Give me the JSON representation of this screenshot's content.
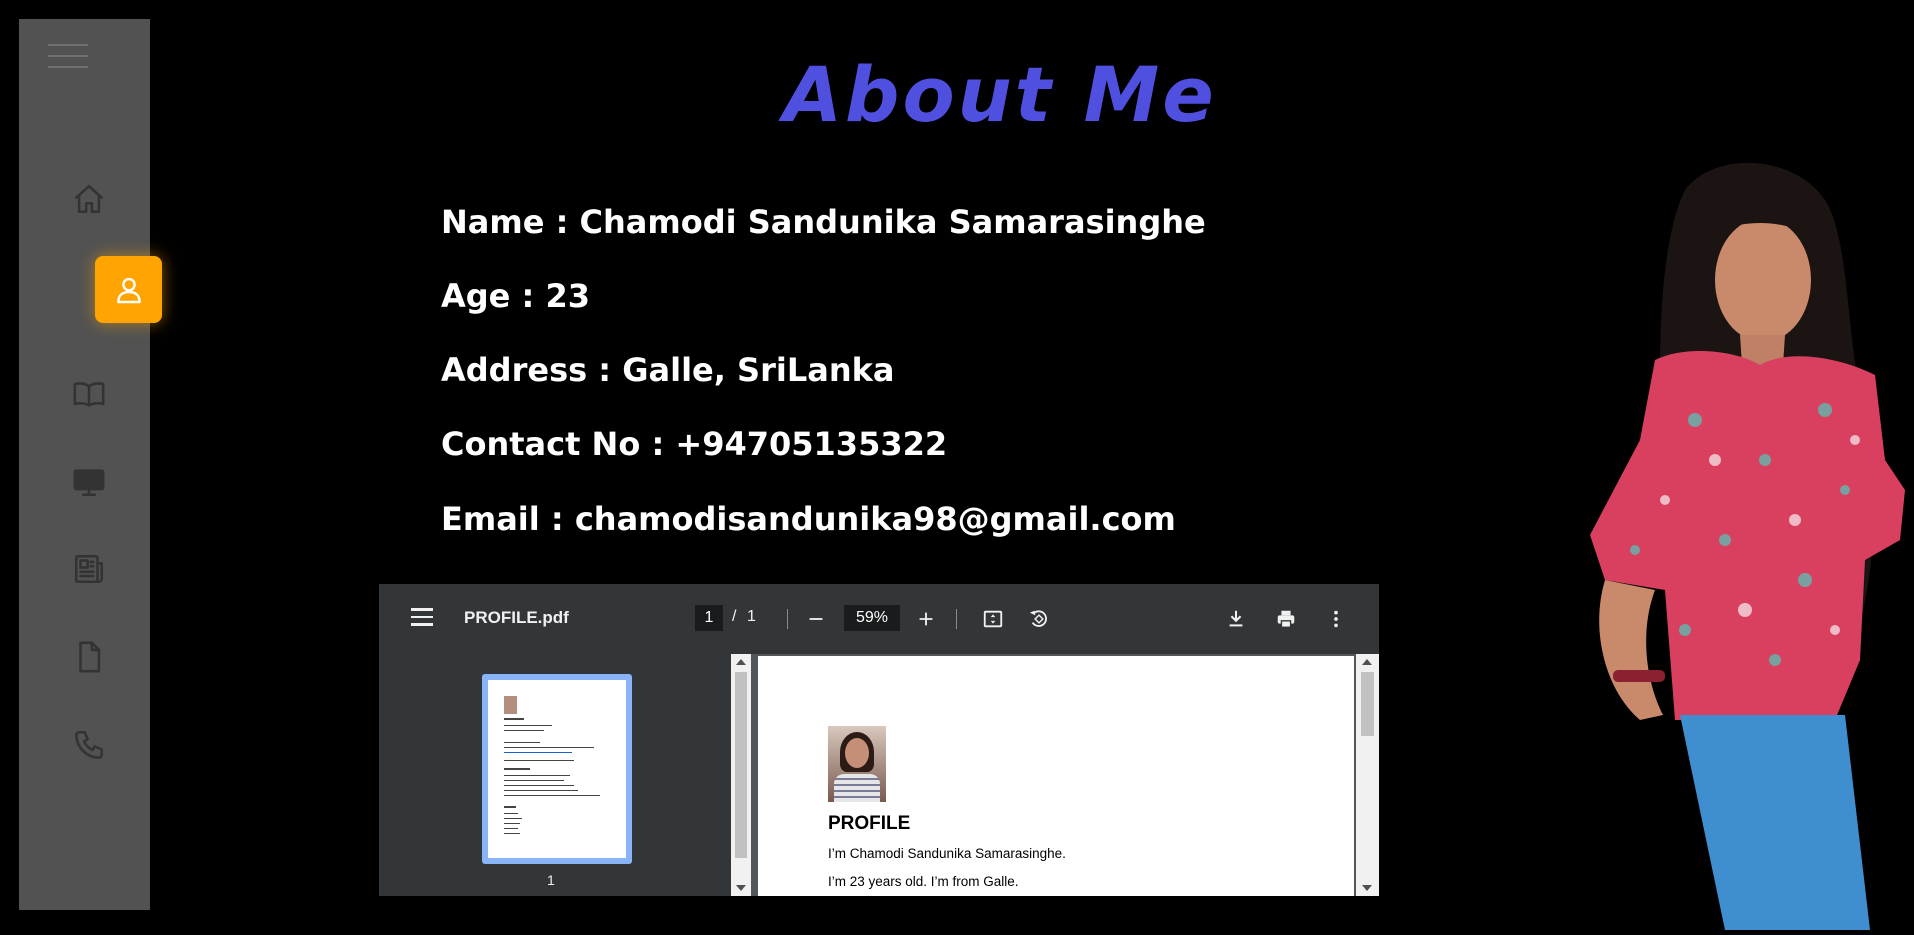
{
  "sidebar": {
    "items": [
      {
        "name": "home",
        "icon": "home-icon"
      },
      {
        "name": "about",
        "icon": "user-icon",
        "active": true
      },
      {
        "name": "education",
        "icon": "book-icon"
      },
      {
        "name": "projects",
        "icon": "monitor-icon"
      },
      {
        "name": "blog",
        "icon": "newspaper-icon"
      },
      {
        "name": "resume",
        "icon": "document-icon"
      },
      {
        "name": "contact",
        "icon": "phone-icon"
      }
    ],
    "active_color": "#ffa400"
  },
  "heading": {
    "title": "About Me",
    "color": "#5050e0"
  },
  "info": {
    "name": "Name : Chamodi Sandunika Samarasinghe",
    "age": "Age : 23",
    "address": "Address : Galle, SriLanka",
    "contact": "Contact No : +94705135322",
    "email": "Email : chamodisandunika98@gmail.com"
  },
  "pdf": {
    "filename": "PROFILE.pdf",
    "current_page": "1",
    "separator": "/",
    "total_pages": "1",
    "zoom": "59%",
    "thumbnail_label": "1",
    "document": {
      "heading": "PROFILE",
      "line1": "I’m Chamodi Sandunika Samarasinghe.",
      "line2": " I’m 23 years old. I’m from Galle."
    }
  }
}
